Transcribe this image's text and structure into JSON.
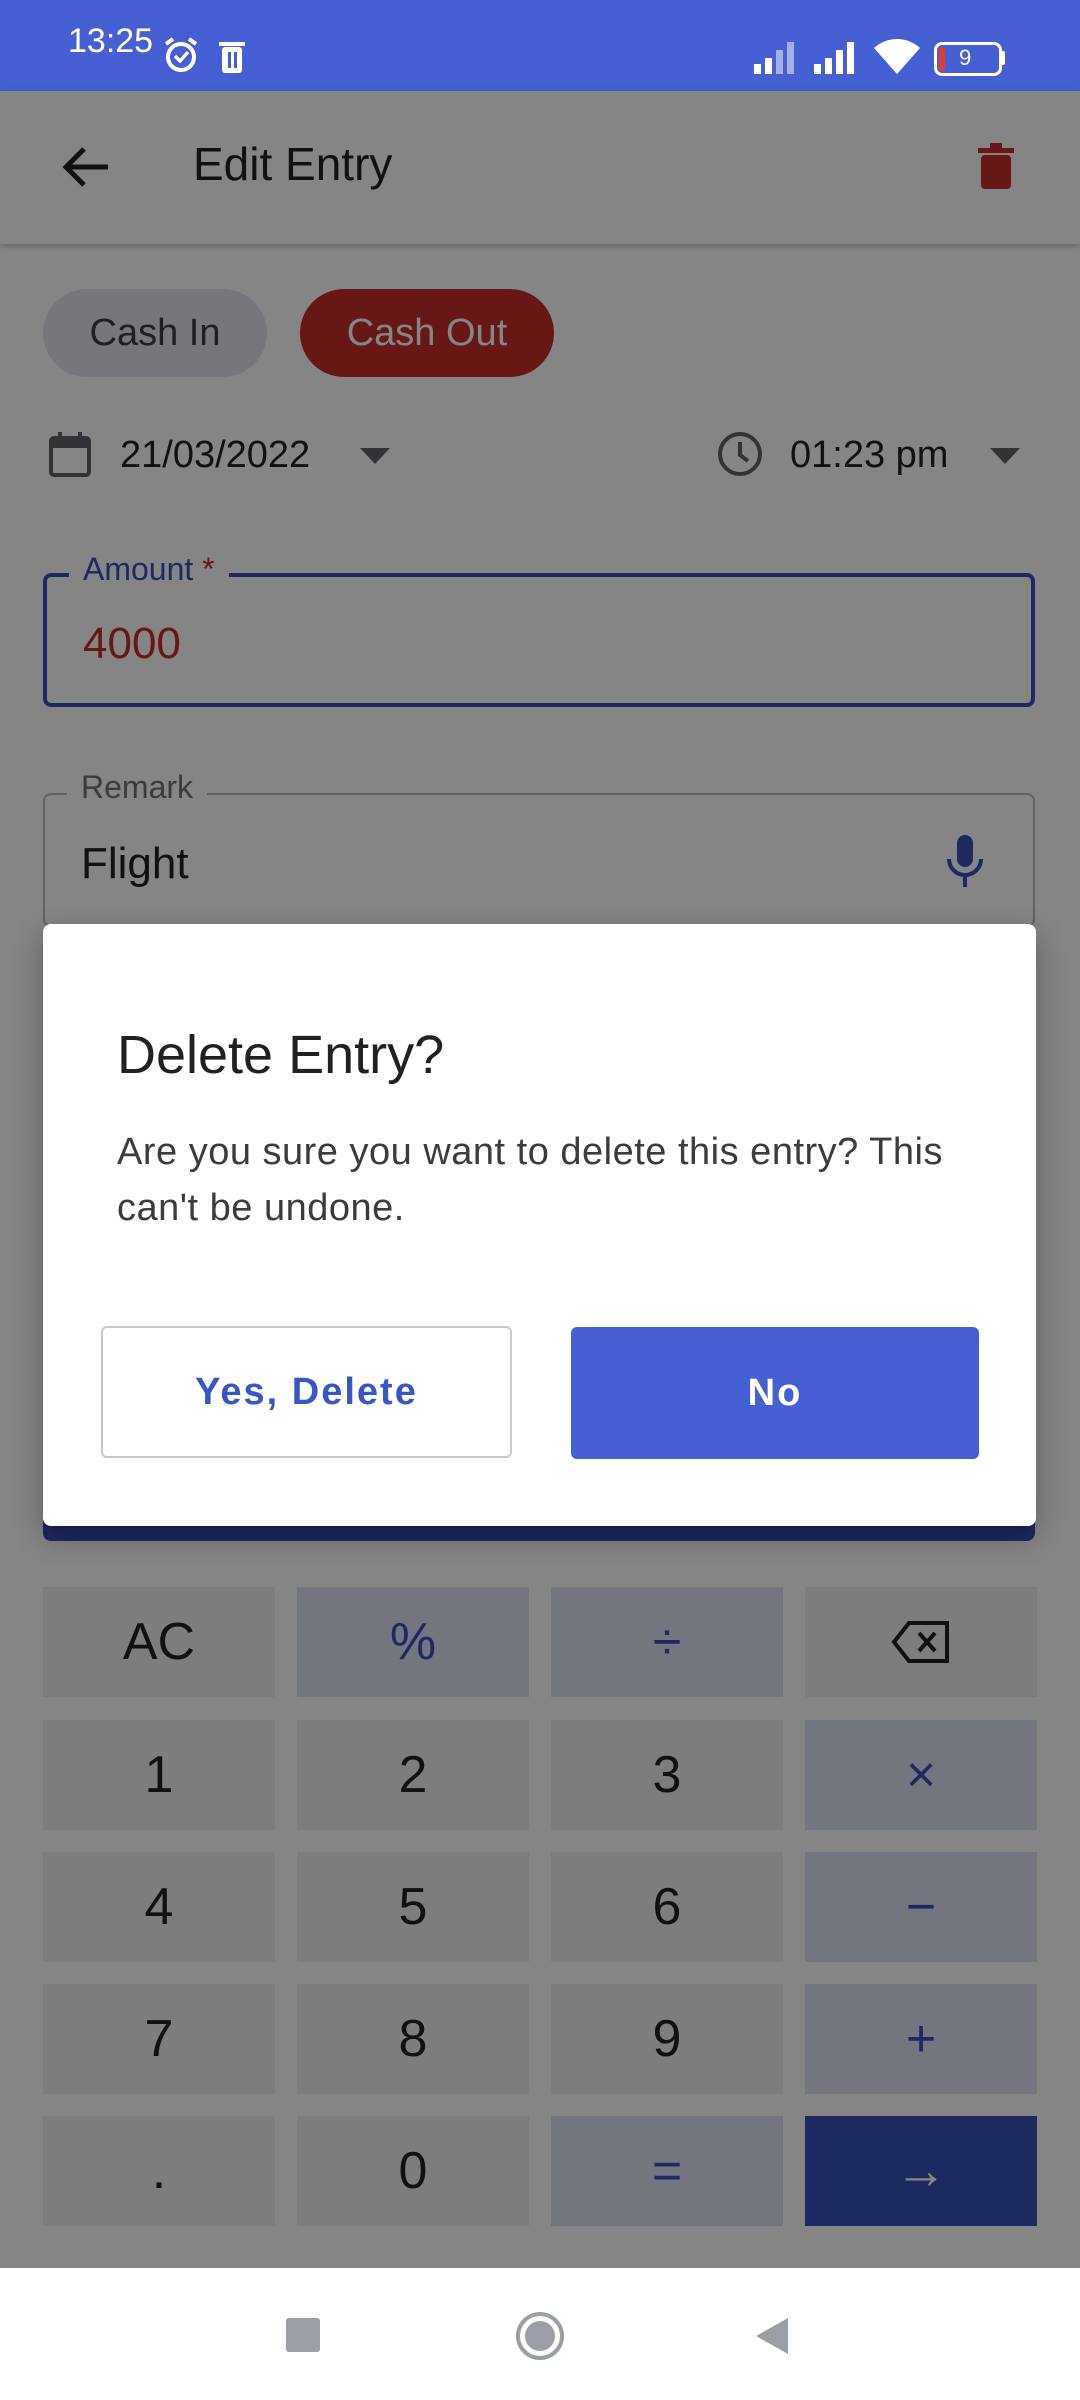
{
  "status_bar": {
    "time": "13:25",
    "battery": "9"
  },
  "app_bar": {
    "title": "Edit Entry"
  },
  "entry_type": {
    "cash_in": "Cash In",
    "cash_out": "Cash Out"
  },
  "date": "21/03/2022",
  "time": "01:23 pm",
  "amount_field": {
    "label": "Amount",
    "required_marker": "*",
    "value": "4000"
  },
  "remark_field": {
    "label": "Remark",
    "value": "Flight"
  },
  "keypad": {
    "rows": [
      [
        "AC",
        "%",
        "÷",
        "⌫"
      ],
      [
        "1",
        "2",
        "3",
        "×"
      ],
      [
        "4",
        "5",
        "6",
        "−"
      ],
      [
        "7",
        "8",
        "9",
        "+"
      ],
      [
        ".",
        "0",
        "=",
        "→"
      ]
    ]
  },
  "dialog": {
    "title": "Delete Entry?",
    "message": "Are you sure you want to delete this entry? This can't be undone.",
    "confirm_label": "Yes, Delete",
    "cancel_label": "No"
  },
  "colors": {
    "primary": "#4560d3",
    "danger": "#c72c2c"
  }
}
